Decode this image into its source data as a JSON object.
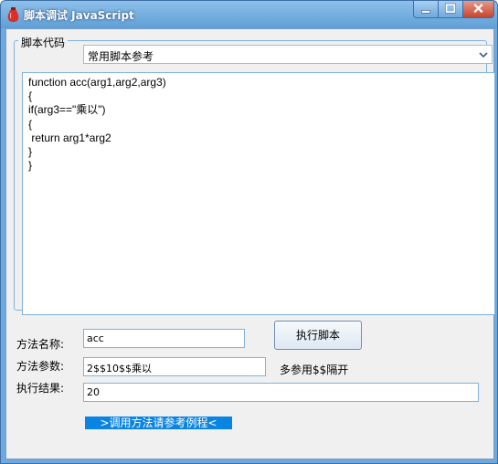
{
  "window": {
    "title": "脚本调试 JavaScript",
    "app_icon": "red-bottle-icon",
    "controls": [
      "minimize-icon",
      "maximize-icon",
      "close-icon"
    ]
  },
  "script_group": {
    "legend": "脚本代码",
    "combo_value": "常用脚本参考",
    "code_lines": [
      "function acc(arg1,arg2,arg3)",
      "{",
      "if(arg3==\"乘以\")",
      "{",
      " return arg1*arg2",
      "}",
      "}"
    ]
  },
  "form": {
    "method_name_label": "方法名称:",
    "method_name_value": "acc",
    "method_params_label": "方法参数:",
    "method_params_value": "2$$10$$乘以",
    "params_hint": "多参用$$隔开",
    "result_label": "执行结果:",
    "result_value": "20",
    "run_button": "执行脚本",
    "help_link": ">调用方法请参考例程<"
  },
  "colors": {
    "title_bar": "#6fa8dc",
    "client_bg": "#f0f0f0",
    "border_accent": "#7fb2dc",
    "link_bg": "#0a84e3"
  }
}
